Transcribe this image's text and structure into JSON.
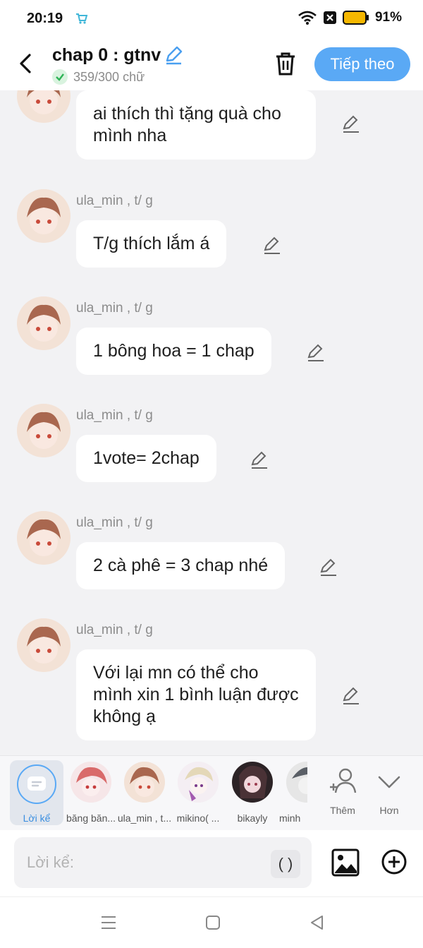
{
  "status_bar": {
    "time": "20:19",
    "battery_percent": "91%",
    "icons": [
      "shopping-cart-icon",
      "wifi-icon",
      "close-box-icon",
      "battery-icon"
    ]
  },
  "header": {
    "title": "chap 0 : gtnv",
    "word_count": "359/300 chữ",
    "next_label": "Tiếp theo",
    "icons": [
      "back-icon",
      "pencil-icon",
      "check-icon",
      "trash-icon"
    ],
    "accent_color": "#5aa9f5"
  },
  "messages": [
    {
      "sender": "",
      "text": "ai thích thì tặng quà cho mình nha"
    },
    {
      "sender": "ula_min , t/ g",
      "text": "T/g thích lắm á"
    },
    {
      "sender": "ula_min , t/ g",
      "text": "1 bông hoa = 1 chap"
    },
    {
      "sender": "ula_min , t/ g",
      "text": "1vote= 2chap"
    },
    {
      "sender": "ula_min , t/ g",
      "text": "2 cà phê = 3 chap nhé"
    },
    {
      "sender": "ula_min , t/ g",
      "text": "Với lại mn có thể cho mình xin 1 bình luận được không ạ"
    }
  ],
  "characters": {
    "narrator_label": "Lời kể",
    "items": [
      {
        "name": "băng băn..."
      },
      {
        "name": "ula_min , t..."
      },
      {
        "name": "mikino( ..."
      },
      {
        "name": "bikayly"
      },
      {
        "name": "minh"
      }
    ],
    "add_label": "Thêm",
    "more_label": "Hơn"
  },
  "composer": {
    "placeholder": "Lời kể:",
    "paren_label": "( )",
    "icons": [
      "image-icon",
      "plus-circle-icon"
    ]
  },
  "nav_bar": {
    "icons": [
      "menu-icon",
      "home-square-icon",
      "back-triangle-icon"
    ]
  }
}
